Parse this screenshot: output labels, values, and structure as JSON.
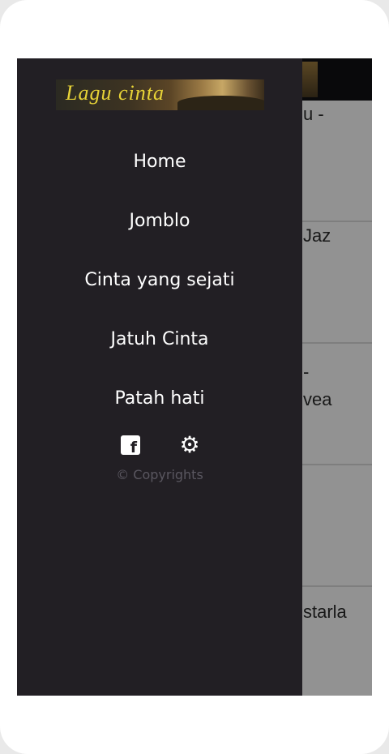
{
  "drawer": {
    "logo_text": "Lagu cinta",
    "menu": [
      {
        "label": "Home"
      },
      {
        "label": "Jomblo"
      },
      {
        "label": "Cinta yang sejati"
      },
      {
        "label": "Jatuh Cinta"
      },
      {
        "label": "Patah hati"
      }
    ],
    "facebook_glyph": "f",
    "settings_glyph": "⚙",
    "copyright": "© Copyrights"
  },
  "background_list": [
    {
      "text": "u -"
    },
    {
      "text": "Jaz"
    },
    {
      "text": "-\nvea"
    },
    {
      "text": ""
    },
    {
      "text": "starla"
    }
  ],
  "icons": [
    "facebook-icon",
    "gear-icon"
  ],
  "colors": {
    "drawer_bg": "#221f24",
    "logo_text": "#e8d437"
  }
}
